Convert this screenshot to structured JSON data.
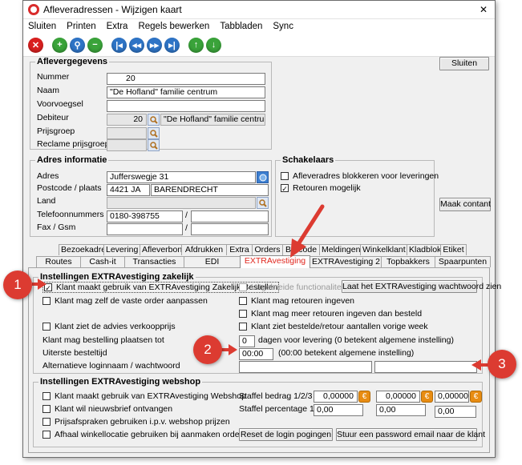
{
  "window": {
    "title": "Afleveradressen - Wijzigen kaart"
  },
  "menu": [
    "Sluiten",
    "Printen",
    "Extra",
    "Regels bewerken",
    "Tabbladen",
    "Sync"
  ],
  "buttons": {
    "close": "Sluiten",
    "maak_contant": "Maak contant"
  },
  "aflevergegevens": {
    "title": "Aflevergegevens",
    "nummer_label": "Nummer",
    "nummer": "20",
    "naam_label": "Naam",
    "naam": "\"De Hofland\" familie centrum",
    "voorvoegsel_label": "Voorvoegsel",
    "debiteur_label": "Debiteur",
    "debiteur_nr": "20",
    "debiteur_naam": "\"De Hofland\" familie centrum",
    "prijsgroep_label": "Prijsgroep",
    "reclame_label": "Reclame prijsgroep"
  },
  "adres": {
    "title": "Adres informatie",
    "adres_label": "Adres",
    "adres": "Jufferswegje 31",
    "postcode_label": "Postcode / plaats",
    "postcode": "4421 JA",
    "plaats": "BARENDRECHT",
    "land_label": "Land",
    "tel_label": "Telefoonnummers",
    "tel1": "0180-398755",
    "sep": "/",
    "fax_label": "Fax / Gsm"
  },
  "schakelaars": {
    "title": "Schakelaars",
    "blokkeren": "Afleveradres blokkeren voor leveringen",
    "retouren": "Retouren mogelijk"
  },
  "tabs_row1": [
    "Bezoekadres",
    "Levering",
    "Afleverbon",
    "Afdrukken",
    "Extra",
    "Orders",
    "Barcode",
    "Meldingen",
    "Winkelklant",
    "Kladblok",
    "Etiket"
  ],
  "tabs_row2": [
    "Routes",
    "Cash-it",
    "Transacties",
    "EDI",
    "EXTRAvestiging",
    "EXTRAvestiging 2",
    "Topbakkers",
    "Spaarpunten"
  ],
  "zakelijk": {
    "title": "Instellingen EXTRAvestiging zakelijk",
    "c1": "Klant maakt gebruik van EXTRAvestiging Zakelijk Bestellen",
    "c_uitgebreid": "Uitgebreide functionaliteit",
    "btn_wachtwoord": "Laat het EXTRAvestiging wachtwoord zien",
    "c2": "Klant mag zelf de vaste order aanpassen",
    "c3": "Klant mag retouren ingeven",
    "c4": "Klant mag meer retouren ingeven dan besteld",
    "c5": "Klant ziet de advies verkoopprijs",
    "c6": "Klant ziet bestelde/retour aantallen vorige week",
    "dagen_label": "Klant mag bestelling plaatsen tot",
    "dagen_value": "0",
    "dagen_text": "dagen voor levering (0 betekent algemene instelling)",
    "tijd_label": "Uiterste besteltijd",
    "tijd_value": "00:00",
    "tijd_text": "(00:00 betekent algemene instelling)",
    "login_label": "Alternatieve loginnaam / wachtwoord"
  },
  "webshop": {
    "title": "Instellingen EXTRAvestiging webshop",
    "c1": "Klant maakt gebruik van EXTRAvestiging Webshop",
    "c2": "Klant wil nieuwsbrief ontvangen",
    "c3": "Prijsafspraken gebruiken i.p.v. webshop prijzen",
    "c4": "Afhaal winkellocatie gebruiken bij aanmaken orders",
    "staffel_bedrag_label": "Staffel bedrag 1/2/3",
    "bedrag": [
      "0,00000",
      "0,00000",
      "0,00000"
    ],
    "staffel_pct_label": "Staffel percentage 1/2/3",
    "pct": [
      "0,00",
      "0,00",
      "0,00"
    ],
    "btn_reset": "Reset de login pogingen",
    "btn_email": "Stuur een password email naar de klant"
  },
  "callouts": [
    "1",
    "2",
    "3"
  ]
}
